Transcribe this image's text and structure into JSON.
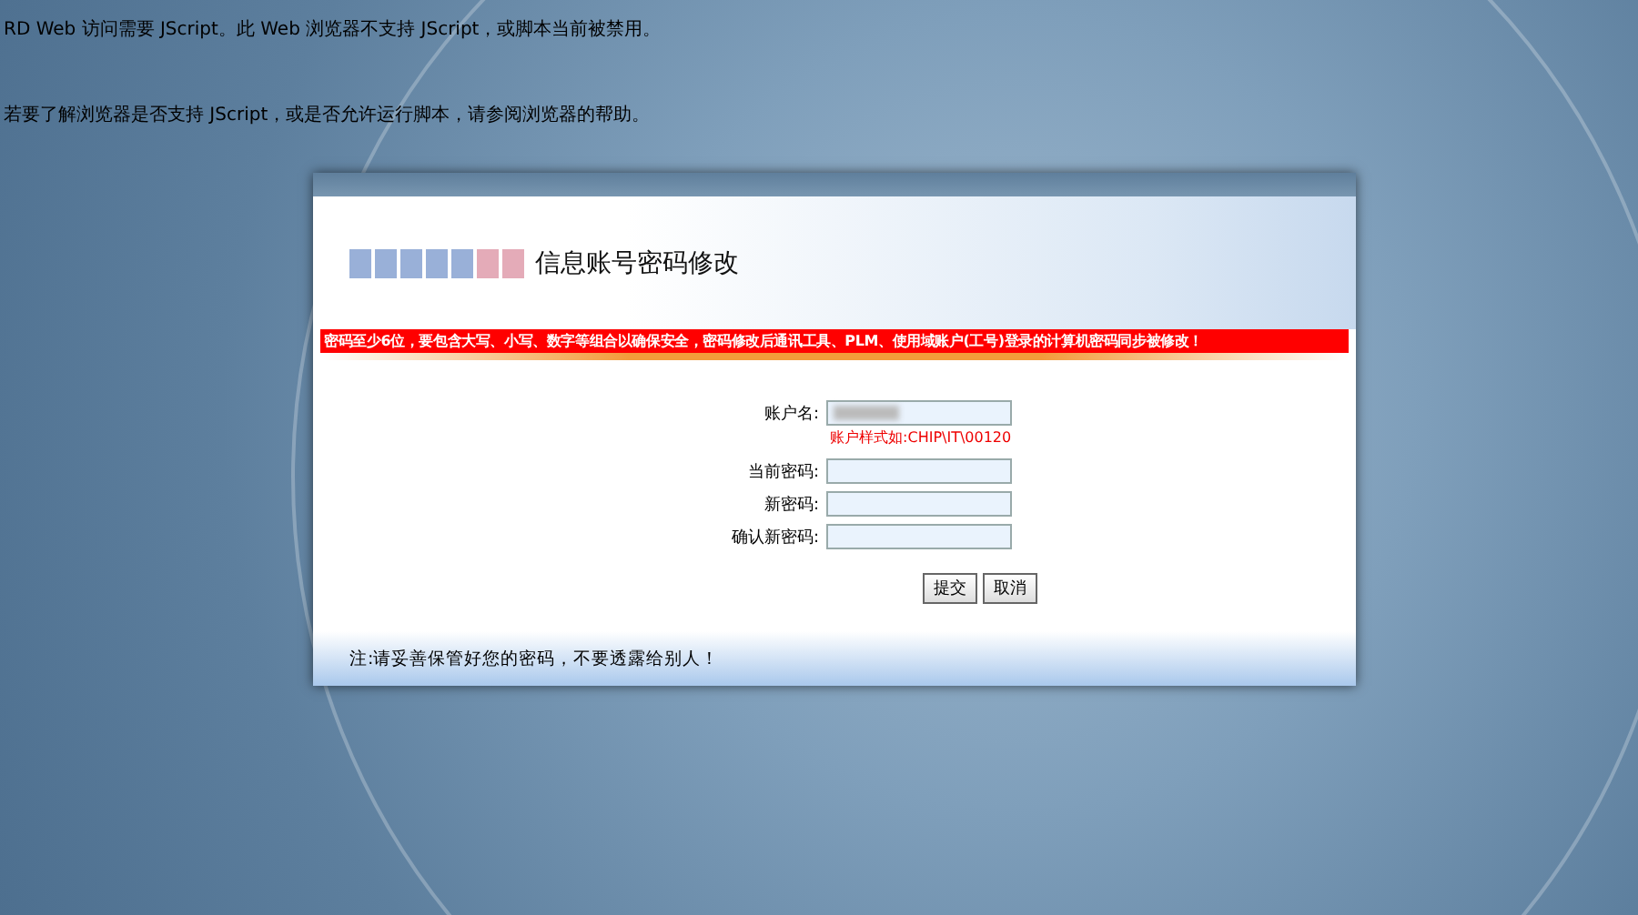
{
  "notices": [
    "RD Web 访问需要 JScript。此 Web 浏览器不支持 JScript，或脚本当前被禁用。",
    "若要了解浏览器是否支持 JScript，或是否允许运行脚本，请参阅浏览器的帮助。"
  ],
  "dialog": {
    "title": "信息账号密码修改",
    "warning": "密码至少6位，要包含大写、小写、数字等组合以确保安全，密码修改后通讯工具、PLM、使用域账户(工号)登录的计算机密码同步被修改！",
    "fields": [
      {
        "label": "账户名:",
        "hint": "账户样式如:CHIP\\IT\\00120"
      },
      {
        "label": "当前密码:"
      },
      {
        "label": "新密码:"
      },
      {
        "label": "确认新密码:"
      }
    ],
    "buttons": [
      "提交",
      "取消"
    ],
    "footer": "注:请妥善保管好您的密码，不要透露给别人！"
  }
}
